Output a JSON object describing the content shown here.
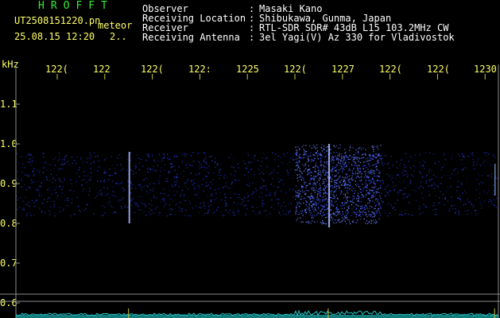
{
  "header": {
    "program_name": "HROFFT",
    "filename": "UT2508151220.pn",
    "meteor_label": "meteor",
    "datetime": "25.08.15 12:20",
    "count": "2..",
    "fields": [
      {
        "label": "Observer",
        "value": "Masaki Kano"
      },
      {
        "label": "Receiving Location",
        "value": "Shibukawa, Gunma, Japan"
      },
      {
        "label": "Receiver",
        "value": "RTL-SDR SDR# 43dB L15 103.2MHz CW"
      },
      {
        "label": "Receiving Antenna",
        "value": "3el Yagi(V) Az 330 for Vladivostok"
      }
    ]
  },
  "axes": {
    "y_unit": "kHz",
    "y_ticks": [
      "1.1",
      "1.0",
      "0.9",
      "0.8",
      "0.7",
      "0.6"
    ],
    "x_ticks": [
      "122(",
      "122",
      "122(",
      "122:",
      "1225",
      "122(",
      "1227",
      "122(",
      "122(",
      "1230"
    ]
  },
  "colors": {
    "text_yellow": "#ffff66",
    "text_white": "#ffffff",
    "title_green": "#33ee33",
    "grid_gray": "#8c8c8c",
    "signal_blue": "#2a45ff",
    "trace_cyan": "#22cccc",
    "marker_yellow": "#cccc33"
  },
  "chart_data": {
    "type": "heatmap",
    "title": "",
    "xlabel": "",
    "ylabel": "kHz",
    "ylim": [
      0.6,
      1.15
    ],
    "xlim": [
      1220,
      1230
    ],
    "noise_band": [
      0.82,
      0.98
    ],
    "meteor_echoes": [
      {
        "time": 1221.5,
        "freq_low": 0.8,
        "freq_high": 0.98,
        "strength": "medium"
      },
      {
        "time": 1225.7,
        "freq_low": 0.79,
        "freq_high": 1.0,
        "strength": "strong"
      },
      {
        "time": 1229.2,
        "freq_low": 0.87,
        "freq_high": 0.95,
        "strength": "weak"
      }
    ],
    "enhanced_interval": [
      1225.0,
      1226.8
    ]
  }
}
